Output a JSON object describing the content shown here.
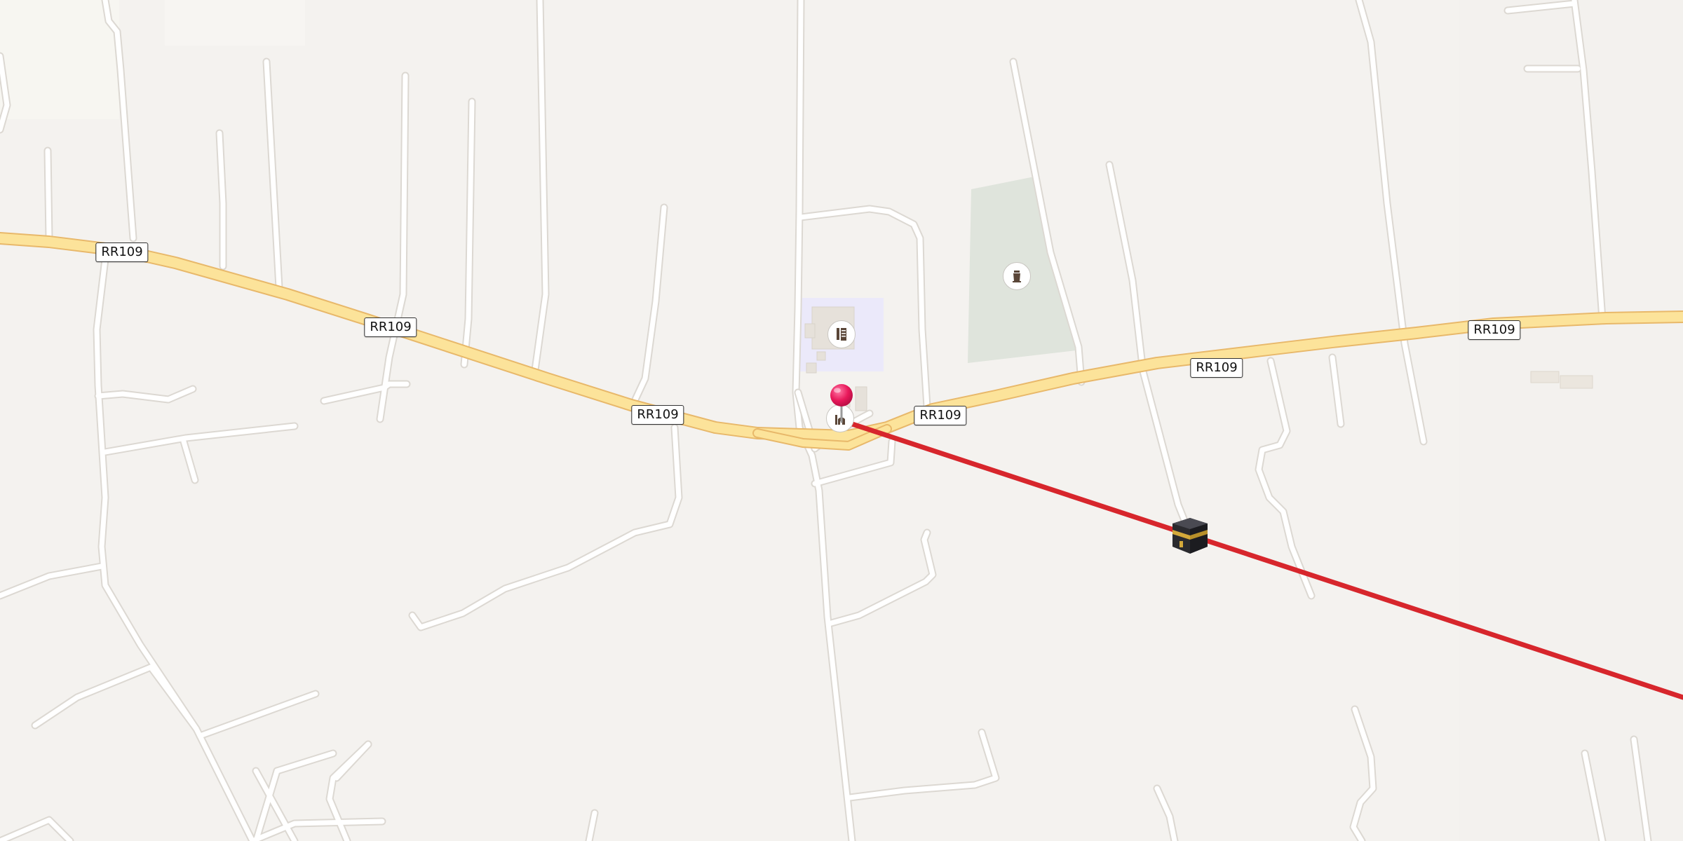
{
  "map": {
    "route_labels": [
      "RR109",
      "RR109",
      "RR109",
      "RR109",
      "RR109",
      "RR109"
    ],
    "colors": {
      "background": "#f4f2ef",
      "minor_road": "#ffffff",
      "minor_road_casing": "#dcd8d2",
      "main_road": "#fce39a",
      "main_road_casing": "#e8b86a",
      "qibla_line": "#d7262c",
      "park_area": "#dfe4dc",
      "school_area": "#ebe9fa",
      "location_pin": "#e8185a"
    },
    "pois": {
      "school": "school-icon",
      "cemetery": "cemetery-icon",
      "mosque": "mosque-icon"
    },
    "markers": {
      "location": "location-pin-icon",
      "qibla": "kaaba-icon"
    }
  }
}
